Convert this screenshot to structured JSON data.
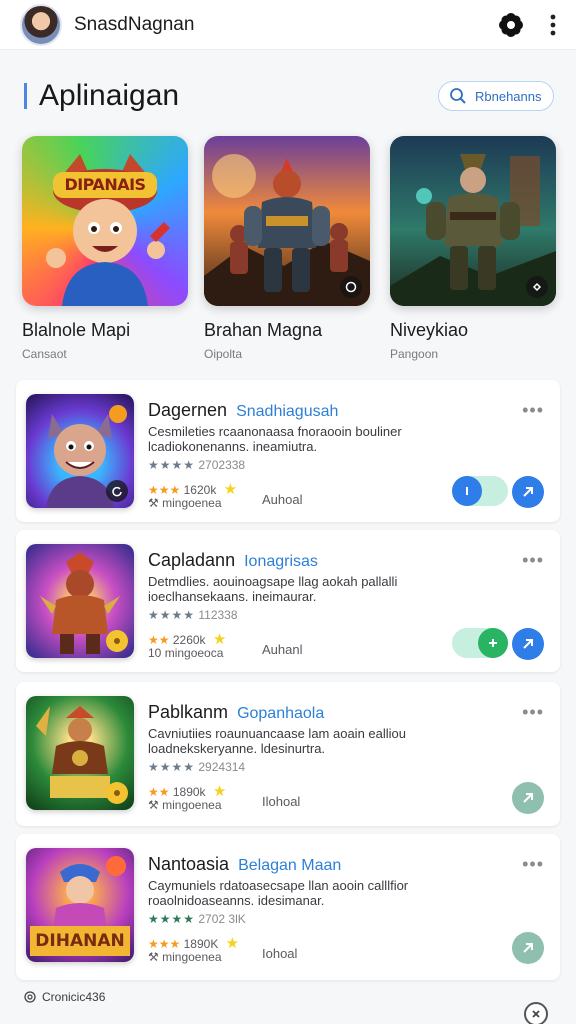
{
  "header": {
    "title": "SnasdNagnan"
  },
  "section": {
    "title": "Aplinaigan",
    "search_label": "Rbnehanns"
  },
  "featured": [
    {
      "name": "Blalnole Mapi",
      "sub": "Cansaot",
      "art_text": "DIPANAIS"
    },
    {
      "name": "Brahan Magna",
      "sub": "Oipolta"
    },
    {
      "name": "Niveykiao",
      "sub": "Pangoon"
    }
  ],
  "list": [
    {
      "title": "Dagernen",
      "title_accent": "Snadhiagusah",
      "desc": "Cesmileties rcaanonaasa fnoraooin bouliner lcadiokonenanns. ineamiutra.",
      "rating": "★★★★",
      "rating_text": "2702338",
      "orange_stars": "★★★",
      "orange_text": "1620k",
      "meta_icon": "⚒",
      "meta_text": "mingoenea",
      "status": "Auhoal"
    },
    {
      "title": "Capladann",
      "title_accent": "Ionagrisas",
      "desc": "Detmdlies. aouinoagsape llag aokah pallalli ioeclhansekaans. ineimaurar.",
      "rating": "★★★★",
      "rating_text": "112338",
      "orange_stars": "★★",
      "orange_text": "2260k",
      "meta_icon": "10",
      "meta_text": "mingoeoca",
      "status": "Auhanl"
    },
    {
      "title": "Pablkanm",
      "title_accent": "Gopanhaola",
      "desc": "Cavniutiies roaunuancaase lam aoain ealliou loadnekskeryanne. ldesinurtra.",
      "rating": "★★★★",
      "rating_text": "2924314",
      "orange_stars": "★★",
      "orange_text": "1890k",
      "meta_icon": "⚒",
      "meta_text": "mingoenea",
      "status": "Ilohoal"
    },
    {
      "title": "Nantoasia",
      "title_accent": "Belagan Maan",
      "desc": "Caymuniels rdatoasecsape llan aooin calllfior roaolnidoaseanns. idesimanar.",
      "rating": "★★★★",
      "rating_text": "2702 3lK",
      "orange_stars": "★★★",
      "orange_text": "1890K",
      "meta_icon": "⚒",
      "meta_text": "mingoenea",
      "status": "Iohoal",
      "art_text": "DIHANAN"
    }
  ],
  "footer": {
    "label": "Cronicic436"
  },
  "colors": {
    "accent": "#2d7fd8",
    "primary_blue": "#2f7de8",
    "green": "#28b463",
    "mint": "#c6efe0",
    "star_orange": "#f39c1f"
  }
}
